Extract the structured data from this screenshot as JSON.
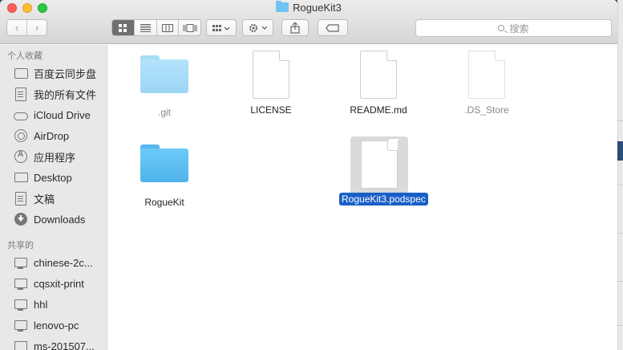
{
  "window": {
    "title": "RogueKit3"
  },
  "toolbar": {
    "back_glyph": "‹",
    "forward_glyph": "›",
    "search_placeholder": "搜索"
  },
  "sidebar": {
    "favorites_header": "个人收藏",
    "favorites": [
      {
        "label": "百度云同步盘",
        "icon": "folder-icon"
      },
      {
        "label": "我的所有文件",
        "icon": "document-icon"
      },
      {
        "label": "iCloud Drive",
        "icon": "cloud-icon"
      },
      {
        "label": "AirDrop",
        "icon": "airdrop-icon"
      },
      {
        "label": "应用程序",
        "icon": "applications-icon"
      },
      {
        "label": "Desktop",
        "icon": "desktop-icon"
      },
      {
        "label": "文稿",
        "icon": "document-icon"
      },
      {
        "label": "Downloads",
        "icon": "download-icon"
      }
    ],
    "shared_header": "共享的",
    "shared": [
      {
        "label": "chinese-2c...",
        "icon": "monitor-icon"
      },
      {
        "label": "cqsxit-print",
        "icon": "monitor-icon"
      },
      {
        "label": "hhl",
        "icon": "monitor-icon"
      },
      {
        "label": "lenovo-pc",
        "icon": "monitor-icon"
      },
      {
        "label": "ms-201507...",
        "icon": "monitor-icon"
      }
    ]
  },
  "files": [
    {
      "name": ".git",
      "kind": "folder",
      "hidden": true
    },
    {
      "name": "LICENSE",
      "kind": "document",
      "hidden": false
    },
    {
      "name": "README.md",
      "kind": "document",
      "hidden": false
    },
    {
      "name": ".DS_Store",
      "kind": "document",
      "hidden": true
    },
    {
      "name": "RogueKit",
      "kind": "folder",
      "hidden": false
    },
    {
      "name": "RogueKit3.podspec",
      "kind": "document",
      "selected": true
    }
  ],
  "colors": {
    "selection": "#1a5fc8",
    "folder_blue": "#56b8ee",
    "close": "#fc5f57",
    "minimize": "#fdbc2e",
    "zoom": "#28c840"
  }
}
